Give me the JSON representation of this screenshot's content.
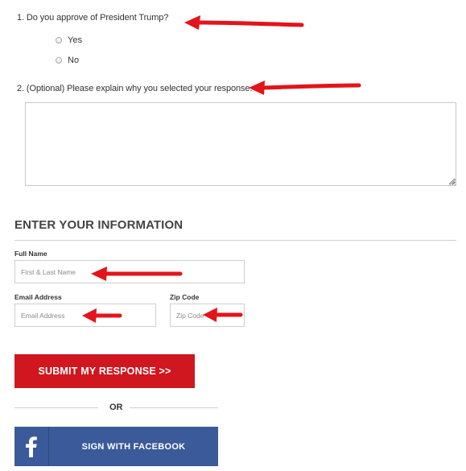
{
  "questions": [
    {
      "number_label": "1. Do you approve of President Trump?",
      "options": [
        {
          "label": "Yes"
        },
        {
          "label": "No"
        }
      ]
    },
    {
      "number_label": "2. (Optional) Please explain why you selected your response.",
      "textarea_value": ""
    }
  ],
  "info_section": {
    "title": "ENTER YOUR INFORMATION"
  },
  "fields": {
    "full_name": {
      "label": "Full Name",
      "placeholder": "First & Last Name",
      "value": ""
    },
    "email": {
      "label": "Email Address",
      "placeholder": "Email Address",
      "value": ""
    },
    "zip": {
      "label": "Zip Code",
      "placeholder": "Zip Code",
      "value": ""
    }
  },
  "submit_label": "SUBMIT MY RESPONSE >>",
  "or_label": "OR",
  "facebook": {
    "label": "SIGN WITH FACEBOOK",
    "icon": "facebook-icon",
    "color": "#3b5a9a"
  },
  "colors": {
    "submit": "#d0161e",
    "annotation_arrow": "#e3141b"
  },
  "annotations": {
    "arrow_icon": "red-arrow-icon"
  }
}
